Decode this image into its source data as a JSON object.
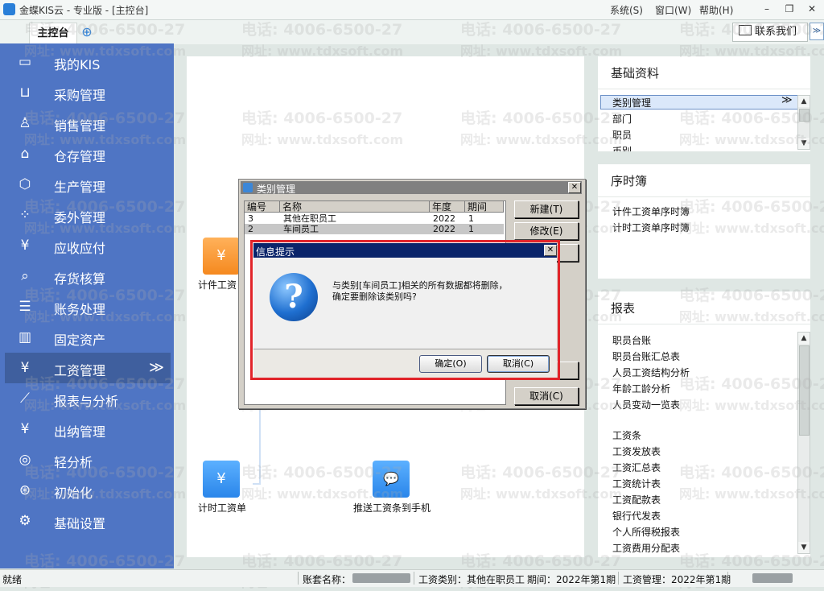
{
  "app": {
    "title": "金蝶KIS云 - 专业版 - [主控台]"
  },
  "menu": {
    "system": "系统(S)",
    "window": "窗口(W)",
    "help": "帮助(H)"
  },
  "window_controls": {
    "minimize": "–",
    "restore": "❐",
    "close": "✕"
  },
  "tabs": [
    {
      "label": "主控台"
    }
  ],
  "tab_add": "⊕",
  "contact": {
    "label": "联系我们"
  },
  "collapse": "≫",
  "sidebar": {
    "items": [
      {
        "label": "我的KIS",
        "icon": "monitor-icon",
        "glyph": "▭"
      },
      {
        "label": "采购管理",
        "icon": "cart-icon",
        "glyph": "⊔"
      },
      {
        "label": "销售管理",
        "icon": "users-icon",
        "glyph": "♙"
      },
      {
        "label": "仓存管理",
        "icon": "warehouse-icon",
        "glyph": "⌂"
      },
      {
        "label": "生产管理",
        "icon": "gear-hex-icon",
        "glyph": "⬡"
      },
      {
        "label": "委外管理",
        "icon": "grid-icon",
        "glyph": "⁘"
      },
      {
        "label": "应收应付",
        "icon": "yuan-box-icon",
        "glyph": "¥"
      },
      {
        "label": "存货核算",
        "icon": "search-house-icon",
        "glyph": "⌕"
      },
      {
        "label": "账务处理",
        "icon": "ledger-icon",
        "glyph": "☰"
      },
      {
        "label": "固定资产",
        "icon": "building-icon",
        "glyph": "▥"
      },
      {
        "label": "工资管理",
        "icon": "salary-icon",
        "glyph": "¥",
        "chevron": "≫"
      },
      {
        "label": "报表与分析",
        "icon": "chart-icon",
        "glyph": "⟋"
      },
      {
        "label": "出纳管理",
        "icon": "cashier-icon",
        "glyph": "¥"
      },
      {
        "label": "轻分析",
        "icon": "analysis-icon",
        "glyph": "◎"
      },
      {
        "label": "初始化",
        "icon": "init-icon",
        "glyph": "⊛"
      },
      {
        "label": "基础设置",
        "icon": "settings-gear-icon",
        "glyph": "⚙"
      }
    ]
  },
  "workspace": {
    "items": [
      {
        "label": "计件工资",
        "icon": "piece-wage-icon",
        "glyph": "¥"
      },
      {
        "label": "计时工资单",
        "icon": "time-wage-icon",
        "glyph": "¥"
      },
      {
        "label": "推送工资条到手机",
        "icon": "push-mobile-icon",
        "glyph": "💬"
      }
    ]
  },
  "right": {
    "basic": {
      "title": "基础资料",
      "items": [
        "类别管理",
        "部门",
        "职员",
        "币别"
      ],
      "selected_chevron": "≫"
    },
    "order": {
      "title": "序时簿",
      "items": [
        "计件工资单序时簿",
        "计时工资单序时簿"
      ]
    },
    "reports": {
      "title": "报表",
      "items": [
        "职员台账",
        "职员台账汇总表",
        "人员工资结构分析",
        "年龄工龄分析",
        "人员变动一览表",
        "",
        "工资条",
        "工资发放表",
        "工资汇总表",
        "工资统计表",
        "工资配款表",
        "银行代发表",
        "个人所得税报表",
        "工资费用分配表"
      ]
    }
  },
  "cat_dialog": {
    "title": "类别管理",
    "close": "✕",
    "headers": [
      "编号",
      "名称",
      "年度",
      "期间"
    ],
    "rows": [
      [
        "3",
        "其他在职员工",
        "2022",
        "1"
      ],
      [
        "2",
        "车间员工",
        "2022",
        "1"
      ]
    ],
    "buttons": {
      "new": "新建(T)",
      "edit": "修改(E)",
      "cancel": "取消(C)"
    }
  },
  "info_dialog": {
    "title": "信息提示",
    "close": "✕",
    "icon_glyph": "?",
    "message_line1": "与类别[车间员工]相关的所有数据都将删除，",
    "message_line2": "确定要删除该类别吗?",
    "ok": "确定(O)",
    "cancel": "取消(C)"
  },
  "status": {
    "ready": "就绪",
    "account_label": "账套名称：",
    "category": "工资类别：其他在职员工",
    "period": "期间：2022年第1期",
    "salary_mgmt": "工资管理：2022年第1期"
  },
  "watermark": {
    "phone": "电话: 4006-6500-27",
    "site": "网址: www.tdxsoft.com"
  },
  "colors": {
    "sidebar": "#4f75c4",
    "sidebar_active": "#3f5f9e",
    "dialog_title": "#0a246a",
    "highlight": "#e1242a"
  }
}
